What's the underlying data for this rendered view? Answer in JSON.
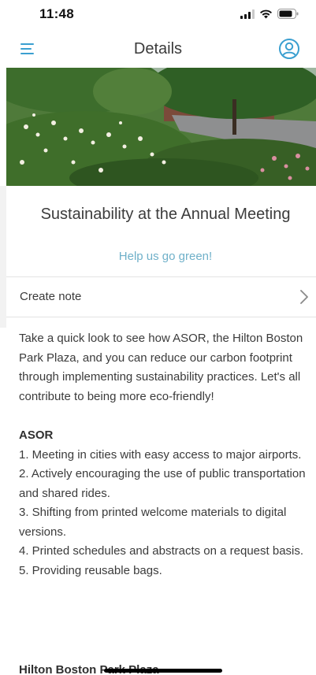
{
  "status_bar": {
    "time": "11:48"
  },
  "nav": {
    "title": "Details"
  },
  "event": {
    "title": "Sustainability at the Annual Meeting",
    "subtitle": "Help us go green!"
  },
  "note": {
    "label": "Create note"
  },
  "body": {
    "intro": "Take a quick look to see how ASOR, the Hilton Boston Park Plaza, and you can reduce our carbon footprint through implementing sustainability practices. Let's all contribute to being more eco-friendly!",
    "sections": [
      {
        "heading": "ASOR",
        "items": [
          "1. Meeting in cities with easy access to major airports.",
          "2. Actively encouraging the use of public transportation and shared rides.",
          "3. Shifting from printed welcome materials to digital versions.",
          "4. Printed schedules and abstracts on a request basis.",
          "5. Providing reusable bags."
        ]
      },
      {
        "heading": "Hilton Boston Park Plaza"
      }
    ]
  },
  "colors": {
    "accent": "#3a9fd0",
    "subtitle": "#6fb0c9",
    "text": "#3b3b3b"
  },
  "icons": {
    "menu": "hamburger-menu-icon",
    "profile": "user-circle-icon",
    "chevron": "chevron-right-icon"
  }
}
